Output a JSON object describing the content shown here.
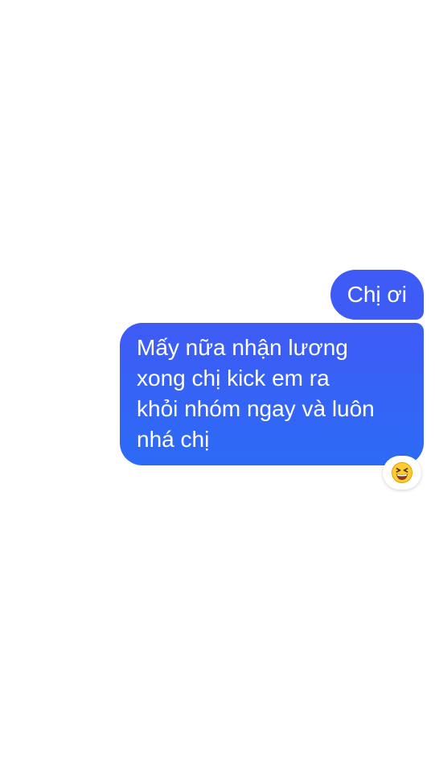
{
  "conversation": {
    "messages": [
      {
        "sender": "me",
        "text": "Chị ơi"
      },
      {
        "sender": "me",
        "text": "Mấy nữa nhận lương\nxong chị kick em ra\nkhỏi nhóm ngay và luôn\nnhá chị"
      }
    ],
    "reaction": {
      "icon": "grinning-squinting-face-icon",
      "colors": {
        "face": "#ffcc33",
        "outline": "#e0a000",
        "mouth": "#8a3a1a",
        "tongue": "#ffffff"
      }
    },
    "bubble_color": "#3f5bf6"
  }
}
